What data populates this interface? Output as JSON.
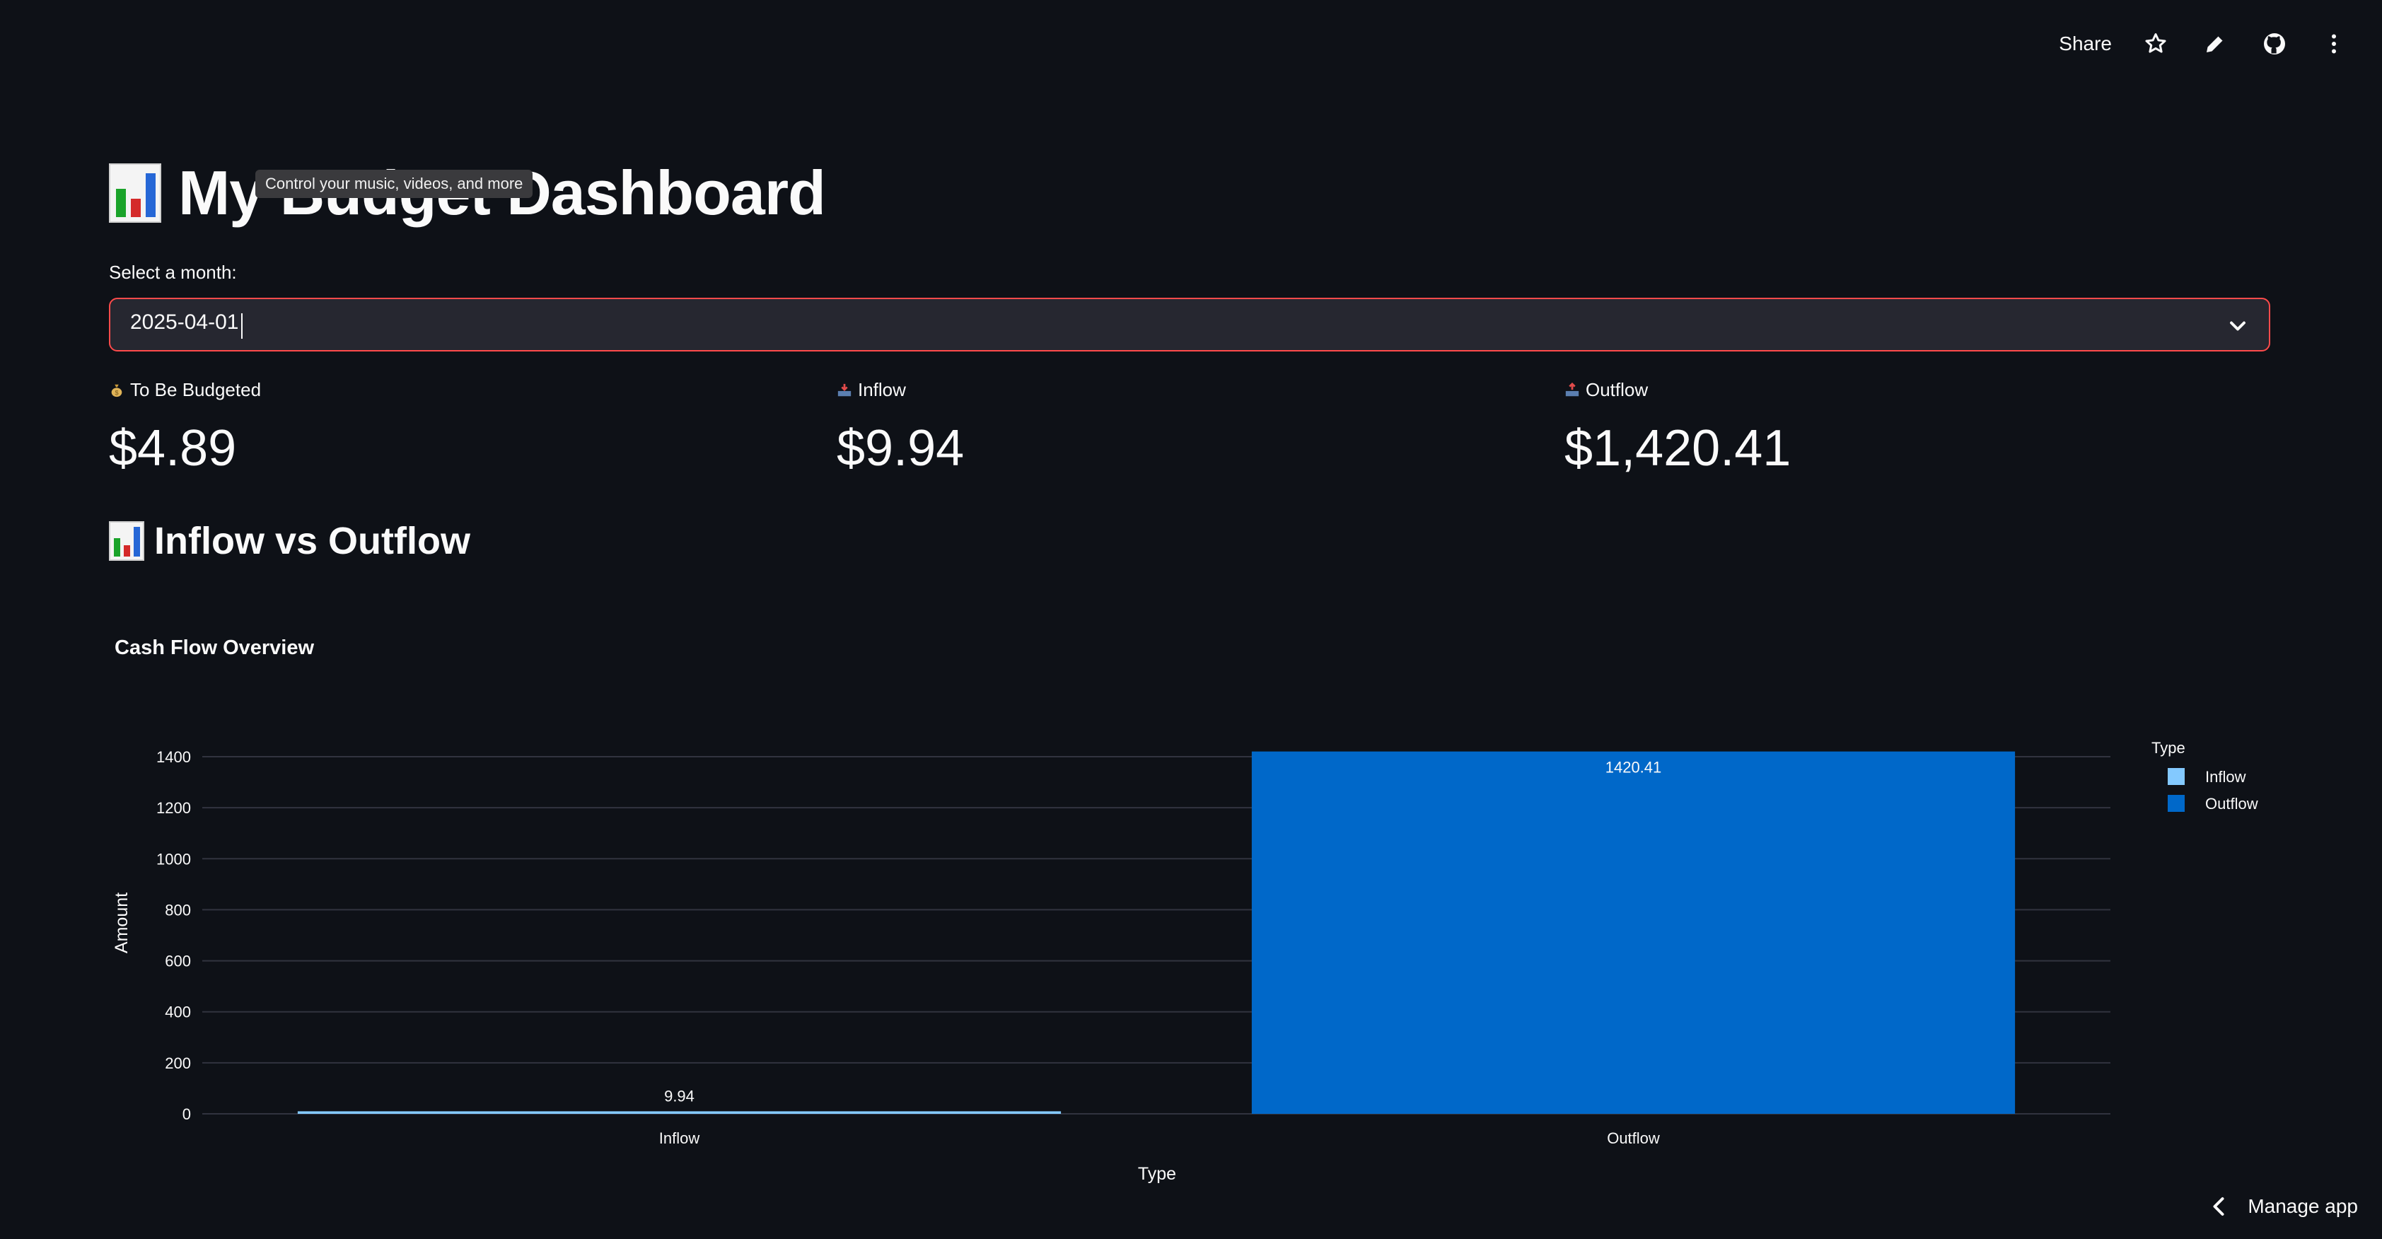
{
  "toolbar": {
    "share_label": "Share",
    "icons": [
      "star-icon",
      "pencil-icon",
      "github-icon",
      "more-vertical-icon"
    ]
  },
  "page": {
    "title": "My Budget Dashboard",
    "title_icon": "bar-chart-emoji-icon"
  },
  "tooltip": {
    "text": "Control your music, videos, and more"
  },
  "month_select": {
    "label": "Select a month:",
    "value": "2025-04-01"
  },
  "metrics": [
    {
      "label": "To Be Budgeted",
      "value": "$4.89",
      "icon": "money-bag-icon"
    },
    {
      "label": "Inflow",
      "value": "$9.94",
      "icon": "inbox-tray-icon"
    },
    {
      "label": "Outflow",
      "value": "$1,420.41",
      "icon": "outbox-tray-icon"
    }
  ],
  "section": {
    "title": "Inflow vs Outflow",
    "icon": "bar-chart-emoji-icon"
  },
  "colors": {
    "background": "#0e1117",
    "inflow": "#83c9ff",
    "outflow": "#0068c9",
    "accent": "#ff4b4b"
  },
  "chart_data": {
    "type": "bar",
    "title": "Cash Flow Overview",
    "xlabel": "Type",
    "ylabel": "Amount",
    "categories": [
      "Inflow",
      "Outflow"
    ],
    "values": [
      9.94,
      1420.41
    ],
    "data_labels": [
      "9.94",
      "1420.41"
    ],
    "ylim": [
      0,
      1420.41
    ],
    "yticks": [
      0,
      200,
      400,
      600,
      800,
      1000,
      1200,
      1400
    ],
    "grid": true,
    "legend": {
      "title": "Type",
      "entries": [
        "Inflow",
        "Outflow"
      ],
      "position": "right"
    }
  },
  "manage_app": {
    "label": "Manage app"
  }
}
